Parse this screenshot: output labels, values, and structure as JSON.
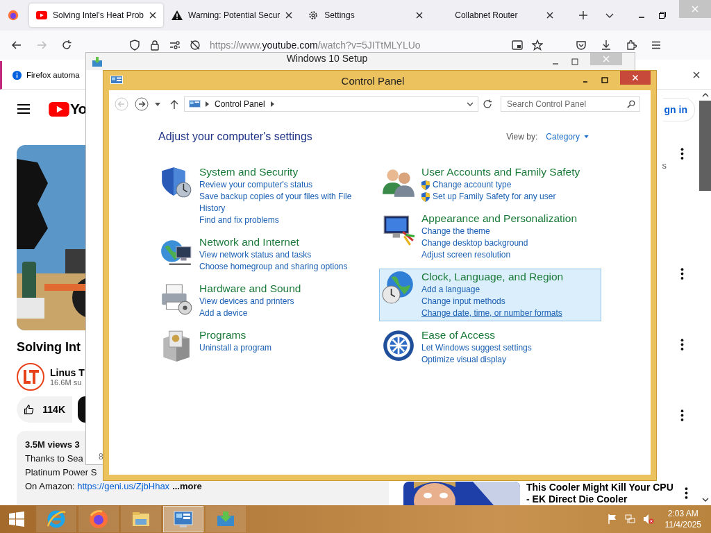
{
  "browser": {
    "tabs": [
      {
        "title": "Solving Intel's Heat Prob",
        "kind": "youtube",
        "selected": true
      },
      {
        "title": "Warning: Potential Secur",
        "kind": "warning",
        "selected": false
      },
      {
        "title": "Settings",
        "kind": "gear",
        "selected": false
      },
      {
        "title": "Collabnet Router",
        "kind": "plain",
        "selected": false
      }
    ],
    "url_prefix": "https://www.",
    "url_domain": "youtube.com",
    "url_path": "/watch?v=5JITtMLYLUo",
    "notification": "Firefox automa"
  },
  "youtube": {
    "logo_text": "Yo",
    "sign_in": "gn in",
    "video_title": "Solving Int",
    "channel_name": "Linus T",
    "subscribers": "16.6M su",
    "likes": "114K",
    "description": {
      "stats": "3.5M views  3",
      "lines": [
        "Thanks to Sea",
        "Platinum Power S"
      ],
      "link_prefix": "On Amazon: ",
      "link": "https://geni.us/ZjbHhax",
      "more": "...more"
    },
    "side_fragment": "s",
    "recommended": {
      "title_line_1": "This Cooler Might Kill Your CPU",
      "title_line_2": "- EK Direct Die Cooler"
    }
  },
  "setup_window": {
    "title": "Windows 10 Setup",
    "corner_text": "8"
  },
  "control_panel": {
    "title": "Control Panel",
    "breadcrumb": "Control Panel",
    "search_placeholder": "Search Control Panel",
    "heading": "Adjust your computer's settings",
    "view_by_label": "View by:",
    "view_by_value": "Category",
    "columns": [
      [
        {
          "kind": "security",
          "title": "System and Security",
          "highlighted": false,
          "links": [
            {
              "text": "Review your computer's status",
              "shield": false
            },
            {
              "text": "Save backup copies of your files with File History",
              "shield": false
            },
            {
              "text": "Find and fix problems",
              "shield": false
            }
          ]
        },
        {
          "kind": "network",
          "title": "Network and Internet",
          "highlighted": false,
          "links": [
            {
              "text": "View network status and tasks",
              "shield": false
            },
            {
              "text": "Choose homegroup and sharing options",
              "shield": false
            }
          ]
        },
        {
          "kind": "hardware",
          "title": "Hardware and Sound",
          "highlighted": false,
          "links": [
            {
              "text": "View devices and printers",
              "shield": false
            },
            {
              "text": "Add a device",
              "shield": false
            }
          ]
        },
        {
          "kind": "programs",
          "title": "Programs",
          "highlighted": false,
          "links": [
            {
              "text": "Uninstall a program",
              "shield": false
            }
          ]
        }
      ],
      [
        {
          "kind": "users",
          "title": "User Accounts and Family Safety",
          "highlighted": false,
          "links": [
            {
              "text": "Change account type",
              "shield": true
            },
            {
              "text": "Set up Family Safety for any user",
              "shield": true
            }
          ]
        },
        {
          "kind": "appearance",
          "title": "Appearance and Personalization",
          "highlighted": false,
          "links": [
            {
              "text": "Change the theme",
              "shield": false
            },
            {
              "text": "Change desktop background",
              "shield": false
            },
            {
              "text": "Adjust screen resolution",
              "shield": false
            }
          ]
        },
        {
          "kind": "clock",
          "title": "Clock, Language, and Region",
          "highlighted": true,
          "links": [
            {
              "text": "Add a language",
              "shield": false
            },
            {
              "text": "Change input methods",
              "shield": false
            },
            {
              "text": "Change date, time, or number formats",
              "shield": false
            }
          ]
        },
        {
          "kind": "ease",
          "title": "Ease of Access",
          "highlighted": false,
          "links": [
            {
              "text": "Let Windows suggest settings",
              "shield": false
            },
            {
              "text": "Optimize visual display",
              "shield": false
            }
          ]
        }
      ]
    ]
  },
  "taskbar": {
    "apps": [
      {
        "kind": "ie",
        "selected": false
      },
      {
        "kind": "firefox",
        "selected": false
      },
      {
        "kind": "explorer",
        "selected": false
      },
      {
        "kind": "control-panel",
        "selected": true
      },
      {
        "kind": "setup",
        "selected": false
      }
    ],
    "time": "2:03 AM",
    "date": "11/4/2025"
  }
}
